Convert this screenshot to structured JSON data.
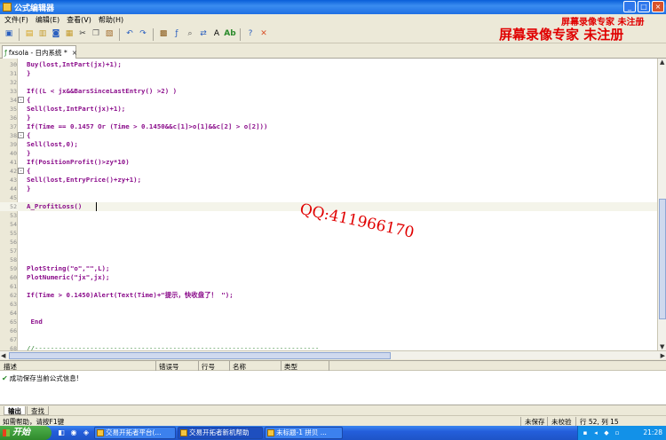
{
  "window": {
    "title": "公式编辑器",
    "controls": [
      "_",
      "□",
      "×"
    ]
  },
  "menu": [
    "文件(F)",
    "编辑(E)",
    "查看(V)",
    "帮助(H)"
  ],
  "watermarks": {
    "top": "屏幕录像专家 未注册",
    "big": "屏幕录像专家  未注册",
    "qq": "QQ:411966170"
  },
  "toolbar": {
    "icons": [
      "new-icon",
      "open-icon",
      "save-icon",
      "save-all-icon",
      "print-icon",
      "cut-icon",
      "copy-icon",
      "paste-icon",
      "undo-icon",
      "redo-icon",
      "compile-icon",
      "insert-function-icon",
      "find-icon",
      "replace-icon",
      "font-icon",
      "bold-icon",
      "help-icon",
      "close-doc-icon"
    ]
  },
  "document_tab": {
    "label": "fxsola - 日内系统 *",
    "close": "×"
  },
  "editor": {
    "lines": [
      {
        "num": "30",
        "text": "Buy(lost,IntPart(jx)+1);",
        "fold": ""
      },
      {
        "num": "31",
        "text": "}",
        "fold": ""
      },
      {
        "num": "32",
        "text": "",
        "fold": ""
      },
      {
        "num": "33",
        "text": "If((L < jx&&BarsSinceLastEntry() >2) )",
        "fold": ""
      },
      {
        "num": "34",
        "text": "{",
        "fold": "-"
      },
      {
        "num": "35",
        "text": "Sell(lost,IntPart(jx)+1);",
        "fold": ""
      },
      {
        "num": "36",
        "text": "}",
        "fold": ""
      },
      {
        "num": "37",
        "text": "If(Time == 0.1457 Or (Time > 0.1450&&c[1]>o[1]&&c[2] > o[2]))",
        "fold": ""
      },
      {
        "num": "38",
        "text": "{",
        "fold": "-"
      },
      {
        "num": "39",
        "text": "Sell(lost,0);",
        "fold": ""
      },
      {
        "num": "40",
        "text": "}",
        "fold": ""
      },
      {
        "num": "41",
        "text": "If(PositionProfit()>zy*10)",
        "fold": ""
      },
      {
        "num": "42",
        "text": "{",
        "fold": "-"
      },
      {
        "num": "43",
        "text": "Sell(lost,EntryPrice()+zy+1);",
        "fold": ""
      },
      {
        "num": "44",
        "text": "}",
        "fold": ""
      },
      {
        "num": "45",
        "text": "",
        "fold": ""
      },
      {
        "num": "52",
        "text": "A_ProfitLoss()",
        "fold": ""
      },
      {
        "num": "53",
        "text": "",
        "fold": ""
      },
      {
        "num": "54",
        "text": "",
        "fold": ""
      },
      {
        "num": "55",
        "text": "",
        "fold": ""
      },
      {
        "num": "56",
        "text": "",
        "fold": ""
      },
      {
        "num": "57",
        "text": "",
        "fold": ""
      },
      {
        "num": "58",
        "text": "",
        "fold": ""
      },
      {
        "num": "59",
        "text": "PlotString(\"o\",\"\",L);",
        "fold": ""
      },
      {
        "num": "60",
        "text": "PlotNumeric(\"jx\",jx);",
        "fold": ""
      },
      {
        "num": "61",
        "text": "",
        "fold": ""
      },
      {
        "num": "62",
        "text": "If(Time > 0.1450)Alert(Text(Time)+\"提示，快收盘了！ \");",
        "fold": ""
      },
      {
        "num": "63",
        "text": "",
        "fold": ""
      },
      {
        "num": "64",
        "text": "",
        "fold": ""
      },
      {
        "num": "65",
        "text": " End",
        "fold": ""
      },
      {
        "num": "66",
        "text": "",
        "fold": ""
      },
      {
        "num": "67",
        "text": "",
        "fold": ""
      },
      {
        "num": "68",
        "text": "//------------------------------------------------------------------------",
        "fold": ""
      }
    ]
  },
  "output": {
    "columns": [
      "描述",
      "错误号",
      "行号",
      "名称",
      "类型"
    ],
    "rows": [
      {
        "text": "成功保存当前公式信息!"
      }
    ],
    "tabs": [
      "输出",
      "查找"
    ]
  },
  "status": {
    "help": "如需帮助，请按F1键",
    "saved": "未保存",
    "verified": "未校验",
    "position": "行 52, 列 15"
  },
  "taskbar": {
    "start": "开始",
    "tasks": [
      "交易开拓者平台(...",
      "交易开拓者新机帮助",
      "未标题-1 拼贝 ..."
    ],
    "clock": "21:28"
  }
}
